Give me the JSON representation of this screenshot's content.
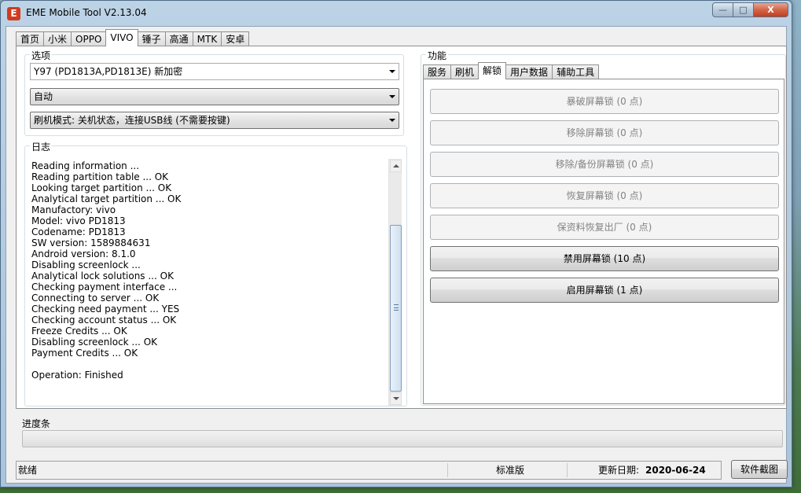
{
  "window": {
    "title": "EME Mobile Tool V2.13.04",
    "app_icon_glyph": "E",
    "minimize_glyph": "—",
    "maximize_glyph": "□",
    "close_glyph": "X"
  },
  "main_tabs": [
    {
      "label": "首页"
    },
    {
      "label": "小米"
    },
    {
      "label": "OPPO"
    },
    {
      "label": "VIVO",
      "active": true
    },
    {
      "label": "锤子"
    },
    {
      "label": "高通"
    },
    {
      "label": "MTK"
    },
    {
      "label": "安卓"
    }
  ],
  "options": {
    "group_label": "选项",
    "model_select": "Y97 (PD1813A,PD1813E) 新加密",
    "mode_select": "自动",
    "flash_mode_select": "刷机模式: 关机状态，连接USB线 (不需要按键)"
  },
  "log": {
    "group_label": "日志",
    "lines": [
      "Reading information ...",
      "Reading partition table ... OK",
      "Looking target partition ... OK",
      "Analytical target partition ... OK",
      "Manufactory: vivo",
      "Model: vivo PD1813",
      "Codename: PD1813",
      "SW version: 1589884631",
      "Android version: 8.1.0",
      "Disabling screenlock ...",
      "Analytical lock solutions ... OK",
      "Checking payment interface ...",
      "Connecting to server ... OK",
      "Checking need payment ... YES",
      "Checking account status ... OK",
      "Freeze Credits ... OK",
      "Disabling screenlock ... OK",
      "Payment Credits ... OK",
      "",
      "Operation: Finished"
    ]
  },
  "functions": {
    "group_label": "功能",
    "tabs": [
      {
        "label": "服务"
      },
      {
        "label": "刷机"
      },
      {
        "label": "解锁",
        "active": true
      },
      {
        "label": "用户数据"
      },
      {
        "label": "辅助工具"
      }
    ],
    "buttons": [
      {
        "label": "暴破屏幕锁 (0 点)",
        "enabled": false
      },
      {
        "label": "移除屏幕锁 (0 点)",
        "enabled": false
      },
      {
        "label": "移除/备份屏幕锁 (0 点)",
        "enabled": false
      },
      {
        "label": "恢复屏幕锁 (0 点)",
        "enabled": false
      },
      {
        "label": "保资料恢复出厂 (0 点)",
        "enabled": false
      },
      {
        "label": "禁用屏幕锁 (10 点)",
        "enabled": true
      },
      {
        "label": "启用屏幕锁 (1 点)",
        "enabled": true
      }
    ]
  },
  "progress": {
    "label": "进度条",
    "value": 0
  },
  "statusbar": {
    "status": "就绪",
    "edition": "标准版",
    "update_label": "更新日期:",
    "update_date": "2020-06-24"
  },
  "screenshot_button": "软件截图",
  "icons": {
    "app": "eme-logo-icon",
    "dropdown": "dropdown-arrow-icon",
    "scroll_up": "scroll-up-arrow-icon",
    "scroll_down": "scroll-down-arrow-icon"
  }
}
